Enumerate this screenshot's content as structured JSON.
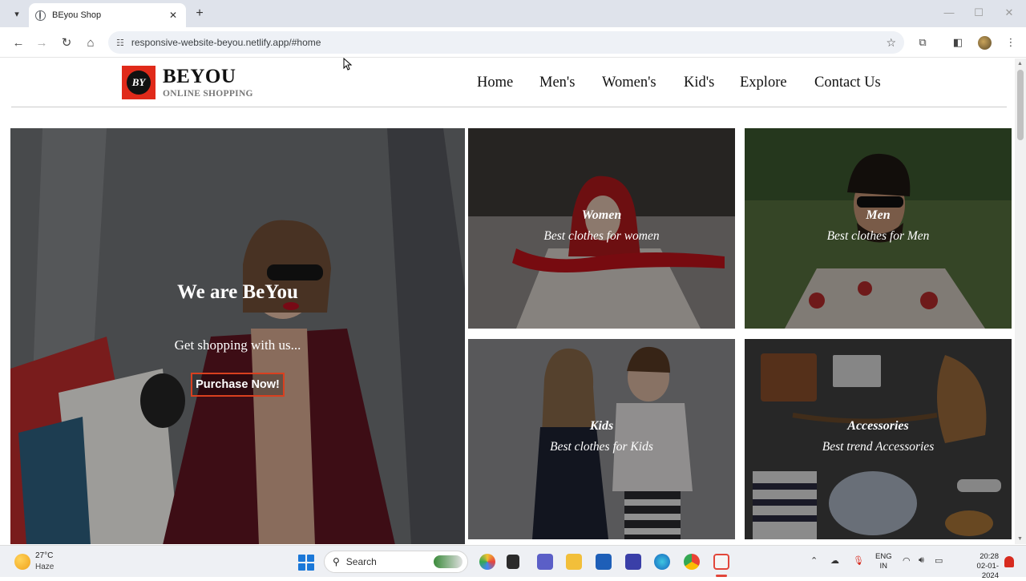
{
  "browser": {
    "tab_title": "BEyou Shop",
    "tab_close": "✕",
    "new_tab": "+",
    "url": "responsive-website-beyou.netlify.app/#home"
  },
  "site": {
    "logo_text": "BY",
    "brand": "BEYOU",
    "tagline": "ONLINE SHOPPING",
    "nav": {
      "home": "Home",
      "mens": "Men's",
      "womens": "Women's",
      "kids": "Kid's",
      "explore": "Explore",
      "contact": "Contact Us"
    }
  },
  "hero": {
    "title": "We are BeYou",
    "subtitle": "Get shopping with us...",
    "button": "Purchase Now!"
  },
  "categories": {
    "women": {
      "title": "Women",
      "subtitle": "Best clothes for women"
    },
    "men": {
      "title": "Men",
      "subtitle": "Best clothes for Men"
    },
    "kids": {
      "title": "Kids",
      "subtitle": "Best clothes for Kids"
    },
    "accessories": {
      "title": "Accessories",
      "subtitle": "Best trend Accessories"
    }
  },
  "taskbar": {
    "temperature": "27°C",
    "condition": "Haze",
    "search_placeholder": "Search",
    "lang_line1": "ENG",
    "lang_line2": "IN",
    "time": "20:28",
    "date": "02-01-2024"
  },
  "colors": {
    "accent_red": "#e02a1a",
    "button_border": "#d9401f",
    "windows_blue": "#1b78d8"
  }
}
